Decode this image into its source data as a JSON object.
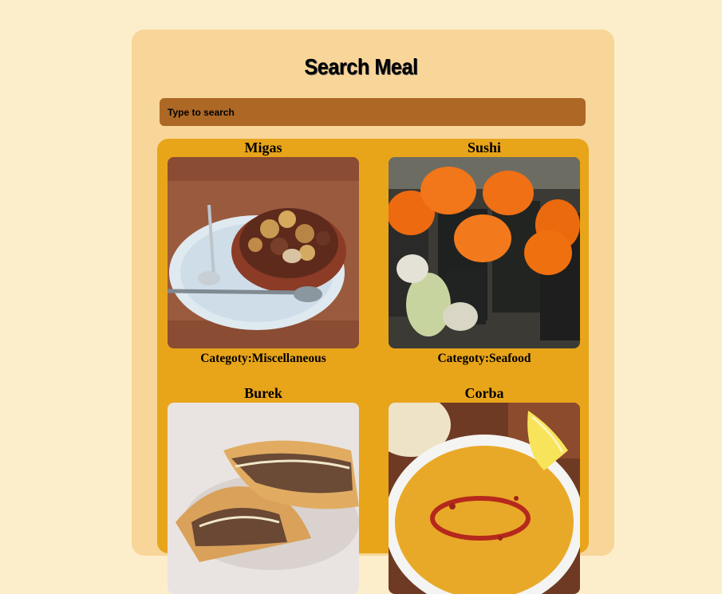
{
  "header": {
    "title": "Search Meal"
  },
  "search": {
    "placeholder": "Type to search",
    "value": ""
  },
  "meals": [
    {
      "name": "Migas",
      "category": "Categoty:Miscellaneous"
    },
    {
      "name": "Sushi",
      "category": "Categoty:Seafood"
    },
    {
      "name": "Burek",
      "category": ""
    },
    {
      "name": "Corba",
      "category": ""
    }
  ],
  "colors": {
    "page_background": "#fdeecb",
    "card_background": "#f8d598",
    "search_background": "#ad6826",
    "results_background": "#e8a51a"
  }
}
